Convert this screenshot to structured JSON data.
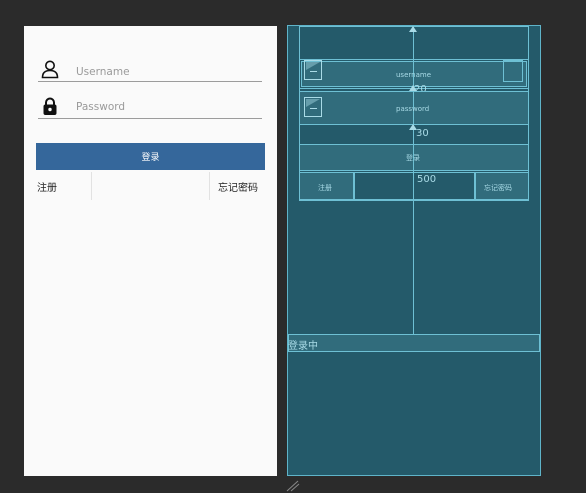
{
  "design": {
    "username_placeholder": "Username",
    "password_placeholder": "Password",
    "login_button": "登录",
    "register_link": "注册",
    "forgot_link": "忘记密码"
  },
  "blueprint": {
    "username_label": "username",
    "password_label": "password",
    "dimension_top": "20",
    "dimension_middle": "30",
    "login_label": "登录",
    "dimension_bottom": "500",
    "register_label": "注册",
    "forgot_label": "忘记密码",
    "loading_label": "登录中"
  },
  "colors": {
    "canvas_background": "#2b2b2b",
    "primary_button": "#35679b",
    "blueprint_background": "#245a6a",
    "blueprint_line": "#6ec0d4"
  },
  "icons": [
    "user-icon",
    "lock-icon",
    "image-placeholder-icon"
  ]
}
